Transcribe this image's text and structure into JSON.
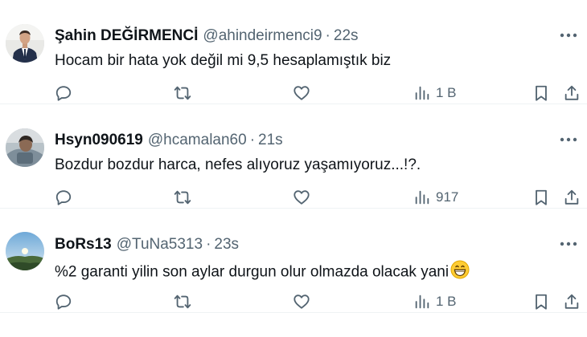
{
  "tweets": [
    {
      "name": "Şahin DEĞİRMENCİ",
      "handle": "@ahindeirmenci9",
      "separator": "·",
      "time": "22s",
      "text": "Hocam bir hata yok değil mi 9,5 hesaplamıştık biz",
      "views": "1 B",
      "avatar_icon": "profile-photo-man-suit"
    },
    {
      "name": "Hsyn090619",
      "handle": "@hcamalan60",
      "separator": "·",
      "time": "21s",
      "text": "Bozdur bozdur harca,  nefes alıyoruz yaşamıyoruz...!?.",
      "views": "917",
      "avatar_icon": "profile-photo-person"
    },
    {
      "name": "BoRs13",
      "handle": "@TuNa5313",
      "separator": "·",
      "time": "23s",
      "text": "%2 garanti yilin son aylar durgun olur olmazda olacak yani",
      "emoji": "grinning-face-emoji",
      "views": "1 B",
      "avatar_icon": "profile-photo-landscape"
    }
  ],
  "colors": {
    "text": "#0f1419",
    "secondary": "#536471",
    "divider": "#eff3f4"
  }
}
